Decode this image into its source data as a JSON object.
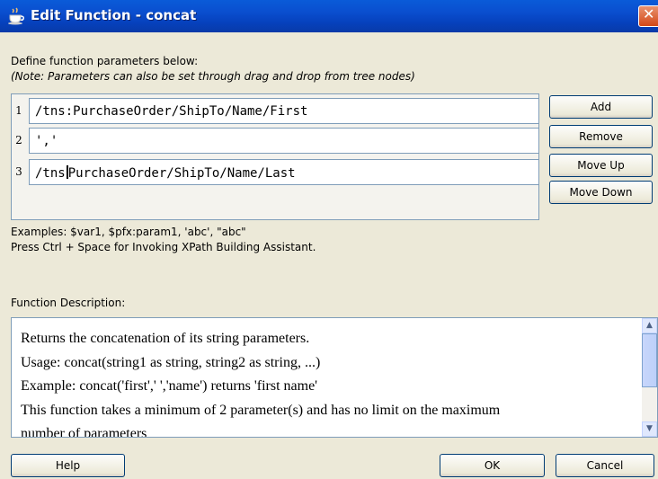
{
  "window": {
    "title": "Edit Function - concat",
    "close_glyph": "✕"
  },
  "intro": {
    "line1": "Define function parameters below:",
    "note": "(Note: Parameters can also be set through drag and drop from tree nodes)"
  },
  "parameters": [
    {
      "index": "1",
      "value": "/tns:PurchaseOrder/ShipTo/Name/First"
    },
    {
      "index": "2",
      "value": "','"
    },
    {
      "index": "3",
      "value_before_caret": "/tns",
      "value_after_caret": "PurchaseOrder/ShipTo/Name/Last"
    }
  ],
  "side_buttons": {
    "add": "Add",
    "remove": "Remove",
    "move_up": "Move Up",
    "move_down": "Move Down"
  },
  "examples": {
    "line1": "Examples: $var1, $pfx:param1, 'abc', \"abc\"",
    "line2": "Press Ctrl + Space for Invoking XPath Building Assistant."
  },
  "description": {
    "label": "Function Description:",
    "lines": [
      "Returns the concatenation of its string parameters.",
      "Usage: concat(string1 as string, string2 as string, ...)",
      "Example: concat('first',' ','name') returns 'first name'",
      "This function takes a minimum of 2 parameter(s) and has no limit on the maximum",
      "number of parameters"
    ]
  },
  "footer": {
    "help": "Help",
    "ok": "OK",
    "cancel": "Cancel"
  },
  "icons": {
    "title": "coffee-cup-icon",
    "close": "close-icon",
    "scroll_up": "scroll-up-arrow-icon",
    "scroll_down": "scroll-down-arrow-icon"
  },
  "colors": {
    "title_bar": "#0a4fd0",
    "dialog_bg": "#ece9d8",
    "field_border": "#7f9db9",
    "close_button": "#d44817"
  }
}
